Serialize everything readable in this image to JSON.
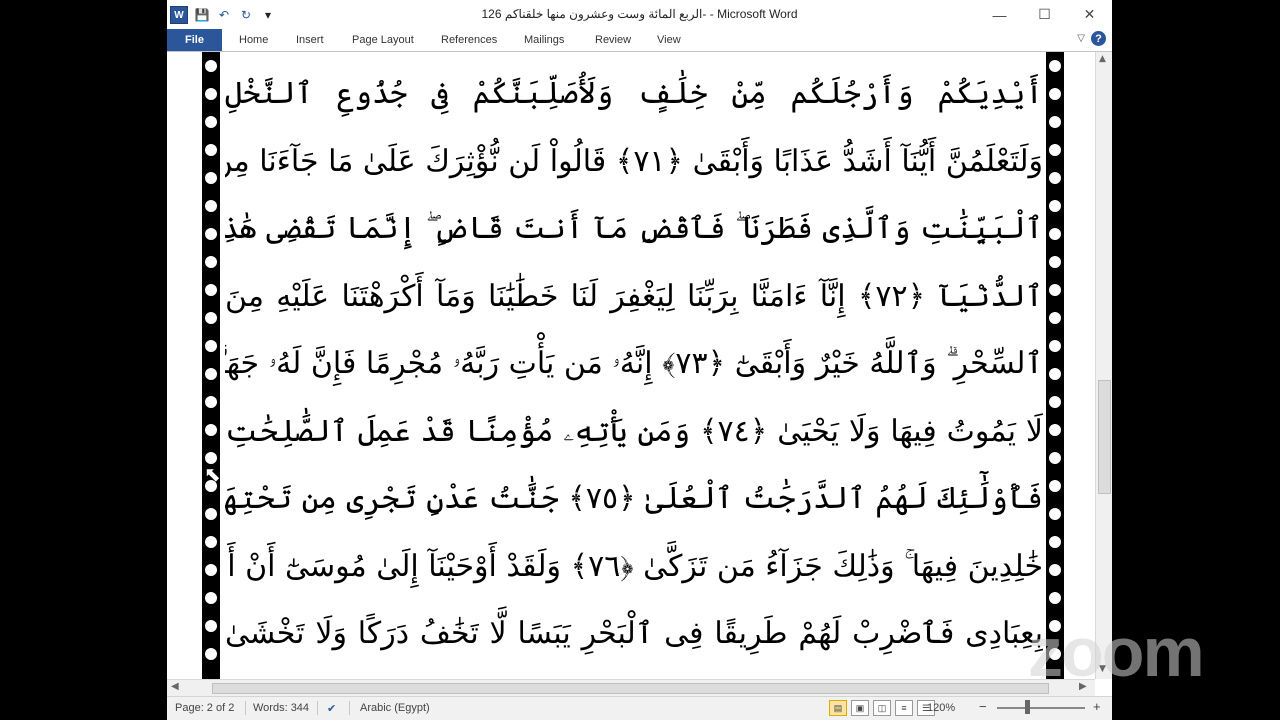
{
  "window": {
    "title": "الربع المائة وست وعشرون منها خلقناكم 126- - Microsoft Word",
    "minimize": "—",
    "maximize": "☐",
    "close": "✕"
  },
  "qat": {
    "word_logo": "W",
    "save": "💾",
    "undo": "↶",
    "redo": "↻",
    "customize": "▾"
  },
  "ribbon": {
    "file": "File",
    "tabs": [
      "Home",
      "Insert",
      "Page Layout",
      "References",
      "Mailings",
      "Review",
      "View"
    ],
    "collapse": "▽",
    "help": "?"
  },
  "document": {
    "lines": [
      "أَيْدِيَكُمْ وَأَرْجُلَكُم مِّنْ خِلَٰفٍ وَلَأُصَلِّبَنَّكُمْ فِى جُذُوعِ ٱلنَّخْلِ",
      "وَلَتَعْلَمُنَّ أَيُّنَآ أَشَدُّ عَذَابًا وَأَبْقَىٰ ﴿٧١﴾ قَالُواْ لَن نُّؤْثِرَكَ عَلَىٰ مَا جَآءَنَا مِنَ",
      "ٱلْبَيِّنَٰتِ وَٱلَّذِى فَطَرَنَا ۖ فَٱقْضِ مَآ أَنتَ قَاضٍ ۖ إِنَّمَا تَقْضِى هَٰذِهِ ٱلْحَيَوٰةَ",
      "ٱلدُّنْيَآ ﴿٧٢﴾ إِنَّآ ءَامَنَّا بِرَبِّنَا لِيَغْفِرَ لَنَا خَطَٰيَٰنَا وَمَآ أَكْرَهْتَنَا عَلَيْهِ مِنَ",
      "ٱلسِّحْرِ ۗ وَٱللَّهُ خَيْرٌ وَأَبْقَىٰٓ ﴿٧٣﴾ إِنَّهُۥ مَن يَأْتِ رَبَّهُۥ مُجْرِمًا فَإِنَّ لَهُۥ جَهَنَّمَ",
      "لَا يَمُوتُ فِيهَا وَلَا يَحْيَىٰ ﴿٧٤﴾ وَمَن يَأْتِهِۦ مُؤْمِنًا قَدْ عَمِلَ ٱلصَّٰلِحَٰتِ",
      "فَأُوْلَٰٓئِكَ لَهُمُ ٱلدَّرَجَٰتُ ٱلْعُلَىٰ ﴿٧٥﴾ جَنَّٰتُ عَدْنٍ تَجْرِى مِن تَحْتِهَا ٱلْأَنْهَٰرُ",
      "خَٰلِدِينَ فِيهَا ۚ وَذَٰلِكَ جَزَآءُ مَن تَزَكَّىٰ ﴿٧٦﴾ وَلَقَدْ أَوْحَيْنَآ إِلَىٰ مُوسَىٰٓ أَنْ أَسْرِ",
      "بِعِبَادِى فَٱضْرِبْ لَهُمْ طَرِيقًا فِى ٱلْبَحْرِ يَبَسًا لَّا تَخَٰفُ دَرَكًا وَلَا تَخْشَىٰ"
    ]
  },
  "scrollbar": {
    "up": "▲",
    "down": "▼",
    "left": "◀",
    "right": "▶"
  },
  "status": {
    "page": "Page: 2 of 2",
    "words": "Words: 344",
    "proofing_icon": "✔",
    "language": "Arabic (Egypt)",
    "zoom": "120%",
    "zoom_out": "−",
    "zoom_in": "+"
  },
  "overlay": {
    "logo": "zoom"
  }
}
